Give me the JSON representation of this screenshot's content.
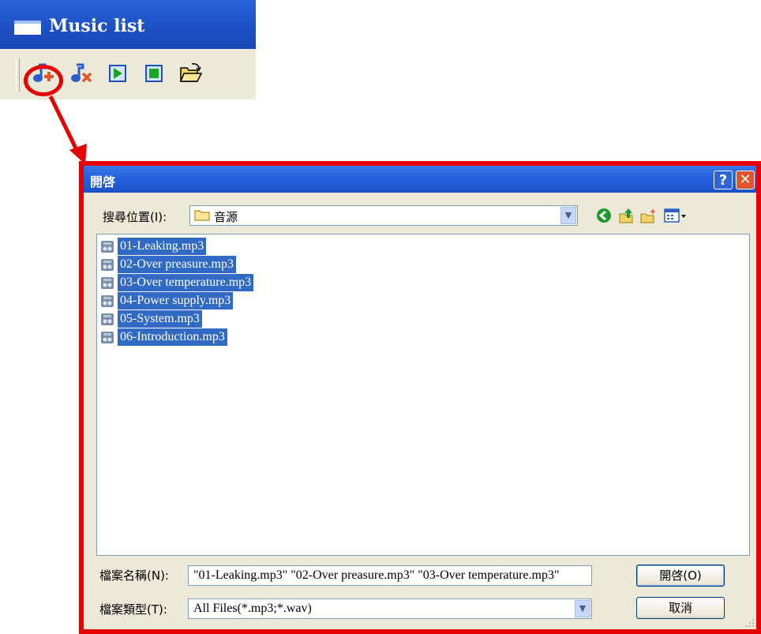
{
  "music_window": {
    "title": "Music list",
    "toolbar": [
      {
        "icon": "add-music-icon"
      },
      {
        "icon": "remove-music-icon"
      },
      {
        "icon": "play-icon"
      },
      {
        "icon": "stop-icon"
      },
      {
        "icon": "open-folder-icon"
      }
    ]
  },
  "annotation": {
    "color": "#e60000",
    "highlight": "add-music-button"
  },
  "dialog": {
    "title": "開啓",
    "help_glyph": "?",
    "close_glyph": "✕",
    "look_in": {
      "label": "搜尋位置(I):",
      "value": "音源"
    },
    "files": [
      {
        "name": "01-Leaking.mp3",
        "selected": true
      },
      {
        "name": "02-Over preasure.mp3",
        "selected": true
      },
      {
        "name": "03-Over temperature.mp3",
        "selected": true
      },
      {
        "name": "04-Power supply.mp3",
        "selected": true
      },
      {
        "name": "05-System.mp3",
        "selected": true
      },
      {
        "name": "06-Introduction.mp3",
        "selected": true
      }
    ],
    "file_name": {
      "label": "檔案名稱(N):",
      "value": "\"01-Leaking.mp3\" \"02-Over preasure.mp3\" \"03-Over temperature.mp3\""
    },
    "file_type": {
      "label": "檔案類型(T):",
      "value": "All Files(*.mp3;*.wav)"
    },
    "open_button": "開啓(O)",
    "cancel_button": "取消",
    "colors": {
      "title_bar": "#2360dd",
      "selection": "#316ac5",
      "frame": "#e60000"
    }
  }
}
